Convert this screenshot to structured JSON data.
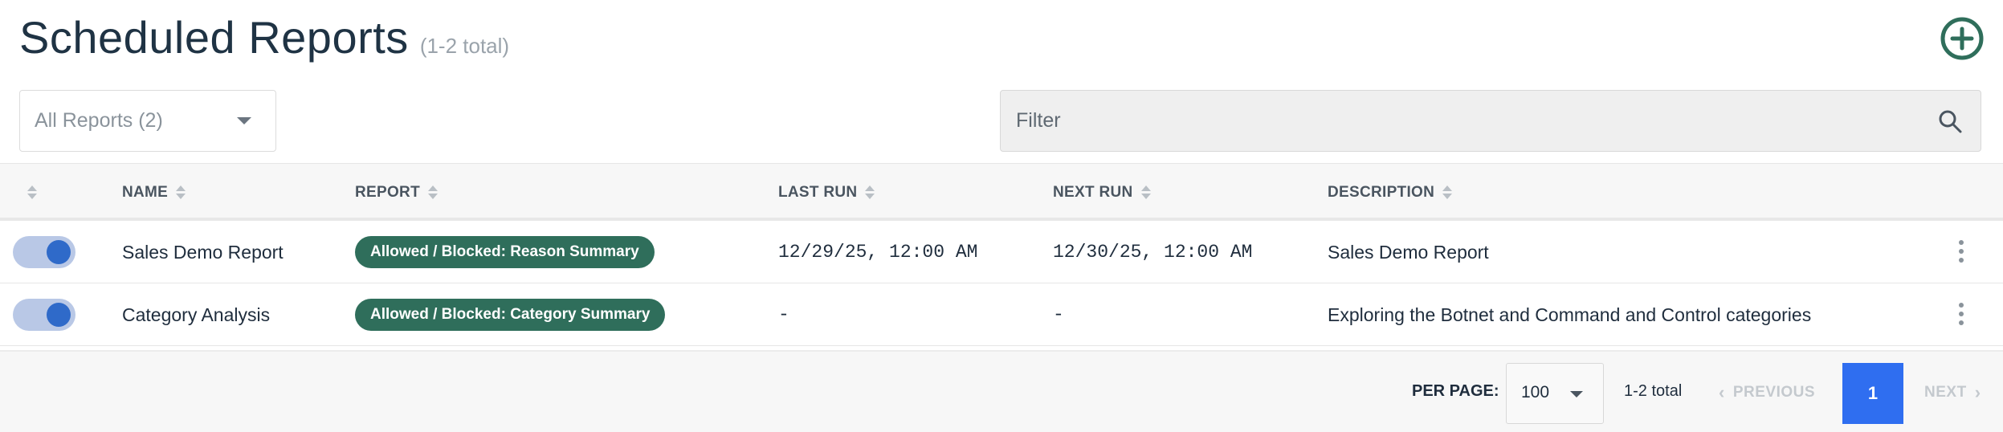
{
  "header": {
    "title": "Scheduled Reports",
    "count": "(1-2 total)"
  },
  "report_select": {
    "label": "All Reports (2)"
  },
  "filter": {
    "placeholder": "Filter"
  },
  "table": {
    "columns": [
      "NAME",
      "REPORT",
      "LAST RUN",
      "NEXT RUN",
      "DESCRIPTION"
    ],
    "rows": [
      {
        "enabled": true,
        "name": "Sales Demo Report",
        "report": "Allowed / Blocked: Reason Summary",
        "last_run": "12/29/25, 12:00 AM",
        "next_run": "12/30/25, 12:00 AM",
        "description": "Sales Demo Report"
      },
      {
        "enabled": true,
        "name": "Category Analysis",
        "report": "Allowed / Blocked: Category Summary",
        "last_run": "-",
        "next_run": "-",
        "description": "Exploring the Botnet and Command and Control categories"
      }
    ]
  },
  "pagination": {
    "per_page_label": "PER PAGE:",
    "per_page_value": "100",
    "total": "1-2 total",
    "previous": "PREVIOUS",
    "current_page": "1",
    "next": "NEXT"
  },
  "colors": {
    "accent": "#2f6e5b",
    "toggle_on": "#2f6ac9",
    "page_active": "#2f6ef0",
    "add_icon": "#2f6e5b"
  },
  "icons": {
    "add": "plus-circle-icon",
    "search": "search-icon",
    "sort": "sort-icon",
    "menu": "kebab-icon"
  }
}
